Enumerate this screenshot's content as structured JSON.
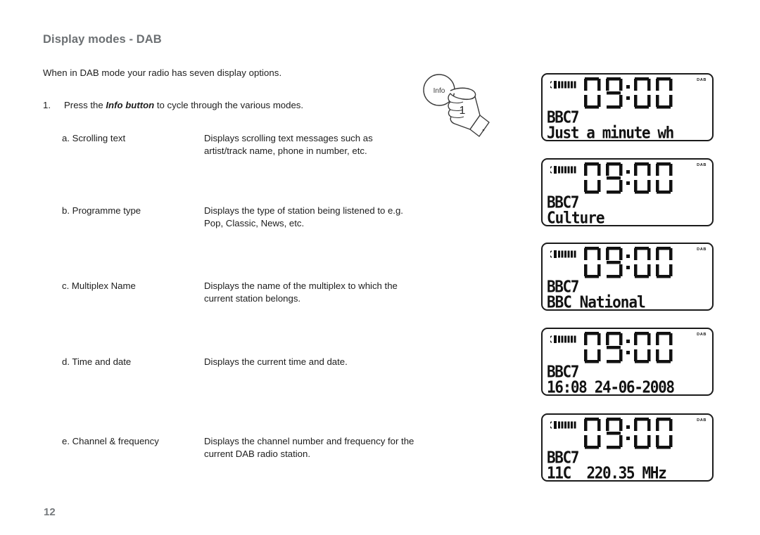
{
  "document": {
    "title": "Display modes - DAB",
    "intro": "When in DAB mode your radio has seven display options.",
    "page_number": "12",
    "title_color": "#6c7073"
  },
  "step": {
    "number": "1.",
    "text_before": "Press the ",
    "text_bold": "Info button",
    "text_after": " to cycle through the various modes."
  },
  "hand_graphic": {
    "button_label": "Info",
    "callout_number": "1"
  },
  "options": [
    {
      "label": "a. Scrolling text",
      "description": "Displays scrolling text messages such as artist/track name, phone in number, etc."
    },
    {
      "label": "b. Programme type",
      "description": "Displays the type of station being listened to e.g. Pop, Classic, News, etc."
    },
    {
      "label": "c. Multiplex Name",
      "description": "Displays the name of the multiplex to which the current station belongs."
    },
    {
      "label": "d. Time and date",
      "description": "Displays the current time and date."
    },
    {
      "label": "e. Channel & frequency",
      "description": "Displays the channel number and frequency for the current DAB radio station."
    }
  ],
  "displays": [
    {
      "signal_icon": "signal-strength-icon",
      "clock": "09:00",
      "mode_tag": "DAB",
      "station": "BBC7",
      "info_line": "Just a minute wh"
    },
    {
      "signal_icon": "signal-strength-icon",
      "clock": "09:00",
      "mode_tag": "DAB",
      "station": "BBC7",
      "info_line": "Culture"
    },
    {
      "signal_icon": "signal-strength-icon",
      "clock": "09:00",
      "mode_tag": "DAB",
      "station": "BBC7",
      "info_line": "BBC National"
    },
    {
      "signal_icon": "signal-strength-icon",
      "clock": "09:00",
      "mode_tag": "DAB",
      "station": "BBC7",
      "info_line": "16:08 24-06-2008"
    },
    {
      "signal_icon": "signal-strength-icon",
      "clock": "09:00",
      "mode_tag": "DAB",
      "station": "BBC7",
      "info_line": "11C  220.35 MHz"
    }
  ]
}
